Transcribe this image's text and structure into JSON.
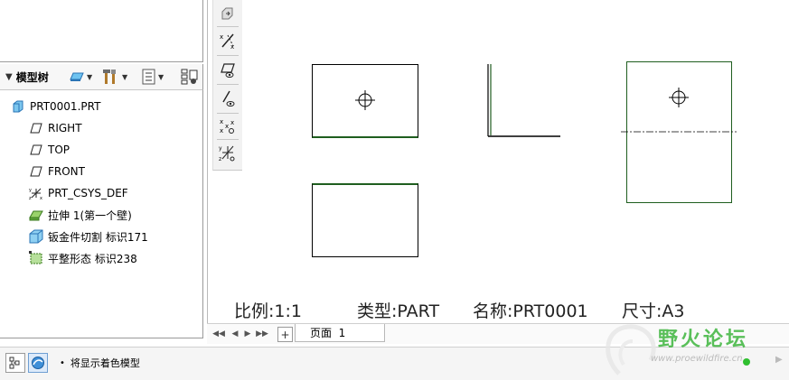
{
  "model_tree": {
    "title": "模型树",
    "items": [
      {
        "label": "PRT0001.PRT",
        "icon": "part-icon"
      },
      {
        "label": "RIGHT",
        "icon": "datum-plane-icon"
      },
      {
        "label": "TOP",
        "icon": "datum-plane-icon"
      },
      {
        "label": "FRONT",
        "icon": "datum-plane-icon"
      },
      {
        "label": "PRT_CSYS_DEF",
        "icon": "coordinate-system-icon"
      },
      {
        "label": "拉伸 1(第一个壁)",
        "icon": "extrude-wall-icon"
      },
      {
        "label": "钣金件切割 标识171",
        "icon": "sheetmetal-cut-icon"
      },
      {
        "label": "平整形态 标识238",
        "icon": "flat-state-icon"
      }
    ]
  },
  "drawing": {
    "scale": "比例:1:1",
    "type": "类型:PART",
    "name": "名称:PRT0001",
    "size": "尺寸:A3"
  },
  "sheet_tabs": {
    "add_label": "+",
    "active_tab": "页面  1"
  },
  "status_bar": {
    "message": "将显示着色模型"
  },
  "watermark": {
    "title": "野火论坛",
    "url": "www.proewildfire.cn"
  },
  "colors": {
    "view_edge_green": "#1f5e1f",
    "watermark_green": "#3db53d",
    "panel_border": "#9a9a9a",
    "status_text": "#222222"
  }
}
